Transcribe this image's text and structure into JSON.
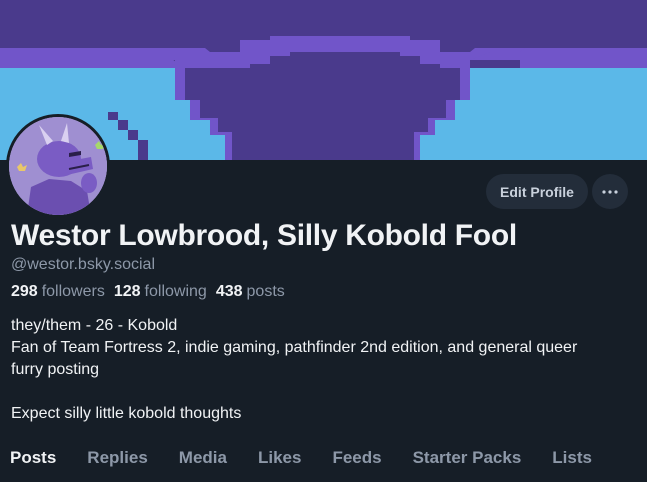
{
  "profile": {
    "display_name": "Westor Lowbrood, Silly Kobold Fool",
    "handle": "@westor.bsky.social",
    "stats": {
      "followers_count": "298",
      "followers_label": "followers",
      "following_count": "128",
      "following_label": "following",
      "posts_count": "438",
      "posts_label": "posts"
    },
    "bio_lines": [
      "they/them - 26 - Kobold",
      "Fan of Team Fortress 2, indie gaming, pathfinder 2nd edition, and general queer",
      "furry posting",
      "",
      "Expect silly little kobold thoughts"
    ]
  },
  "actions": {
    "edit_profile_label": "Edit Profile",
    "more_label": "···"
  },
  "tabs": [
    {
      "label": "Posts",
      "active": true
    },
    {
      "label": "Replies",
      "active": false
    },
    {
      "label": "Media",
      "active": false
    },
    {
      "label": "Likes",
      "active": false
    },
    {
      "label": "Feeds",
      "active": false
    },
    {
      "label": "Starter Packs",
      "active": false
    },
    {
      "label": "Lists",
      "active": false
    }
  ],
  "colors": {
    "background": "#161e27",
    "banner_purple_dark": "#4a3a8c",
    "banner_purple_light": "#7155c9",
    "banner_sky": "#5bb8e8",
    "text_primary": "#f1f3f5",
    "text_secondary": "#8d98a8",
    "button_bg": "#232d3a"
  },
  "icons": {
    "more": "more-horizontal-icon",
    "avatar": "kobold-avatar-image"
  }
}
